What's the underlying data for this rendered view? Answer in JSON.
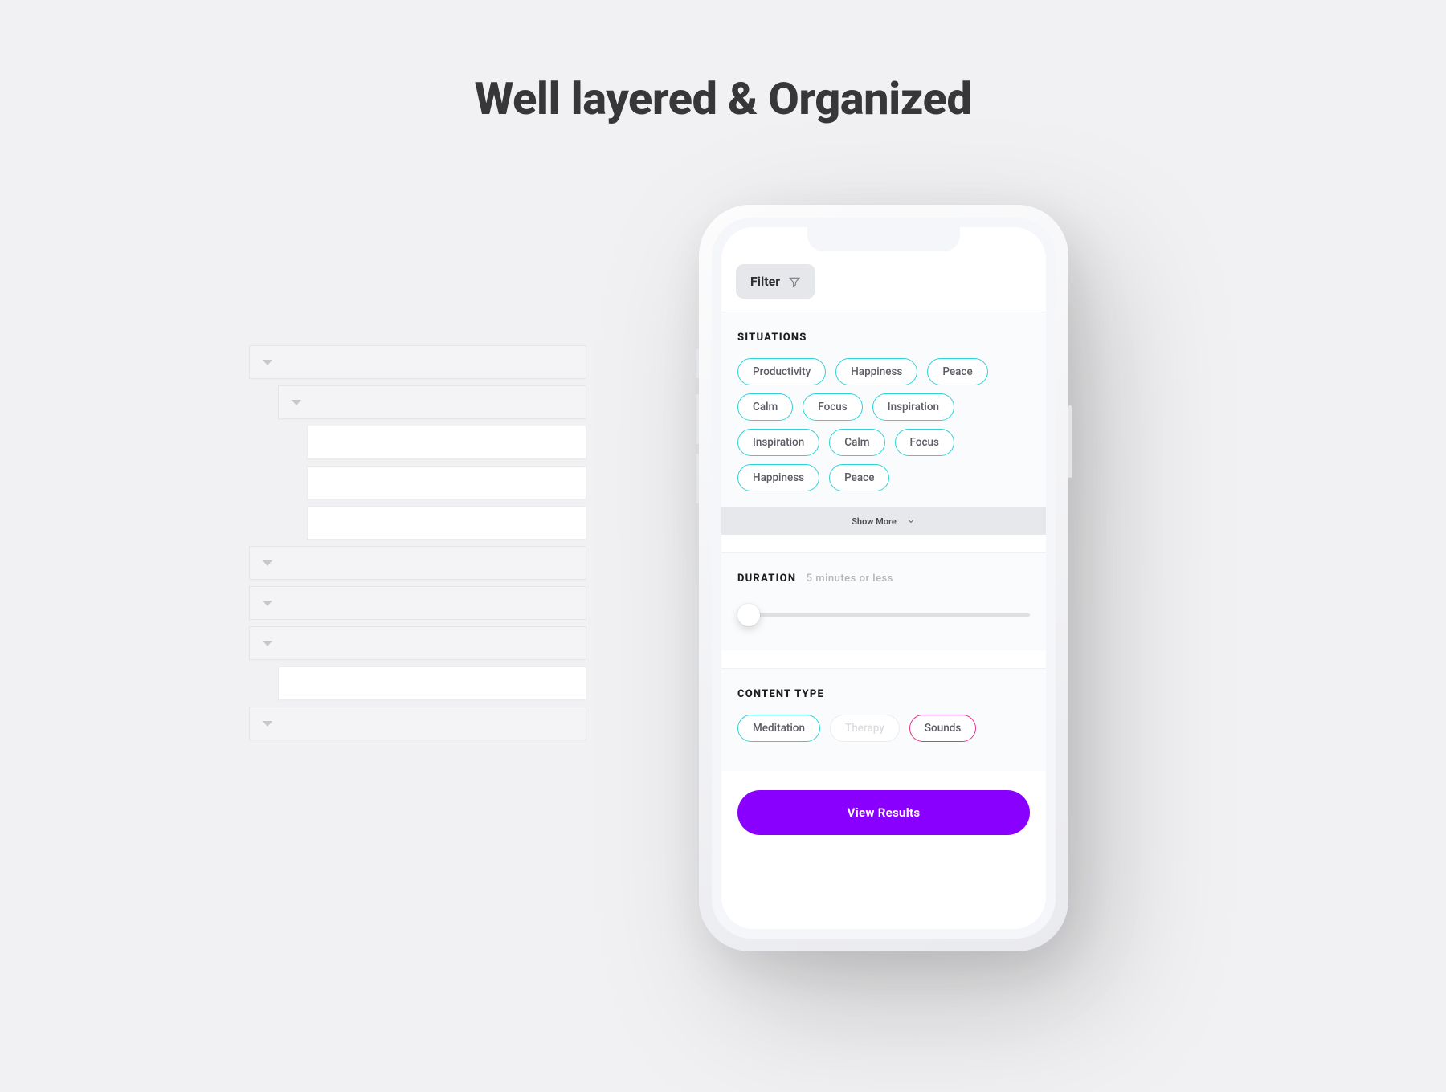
{
  "heading": "Well layered & Organized",
  "layers": {
    "rows": [
      {
        "kind": "group",
        "indent": 0
      },
      {
        "kind": "group",
        "indent": 1
      },
      {
        "kind": "item",
        "indent": 2
      },
      {
        "kind": "item",
        "indent": 2
      },
      {
        "kind": "item",
        "indent": 2
      },
      {
        "kind": "group",
        "indent": 0
      },
      {
        "kind": "group",
        "indent": 0
      },
      {
        "kind": "group",
        "indent": 0
      },
      {
        "kind": "item",
        "indent": 1
      },
      {
        "kind": "group",
        "indent": 0
      }
    ]
  },
  "phone": {
    "filter_label": "Filter",
    "situations": {
      "title": "SITUATIONS",
      "chips": [
        "Productivity",
        "Happiness",
        "Peace",
        "Calm",
        "Focus",
        "Inspiration",
        "Inspiration",
        "Calm",
        "Focus",
        "Happiness",
        "Peace"
      ],
      "show_more": "Show More"
    },
    "duration": {
      "title": "DURATION",
      "value_text": "5 minutes or less",
      "slider_position": 0
    },
    "content_type": {
      "title": "CONTENT TYPE",
      "chips": [
        {
          "label": "Meditation",
          "style": "teal"
        },
        {
          "label": "Therapy",
          "style": "muted"
        },
        {
          "label": "Sounds",
          "style": "pink"
        }
      ]
    },
    "cta_label": "View Results"
  },
  "colors": {
    "accent_cta": "#8a00ff",
    "chip_teal": "#2ed3d8",
    "chip_pink": "#e9318f"
  }
}
